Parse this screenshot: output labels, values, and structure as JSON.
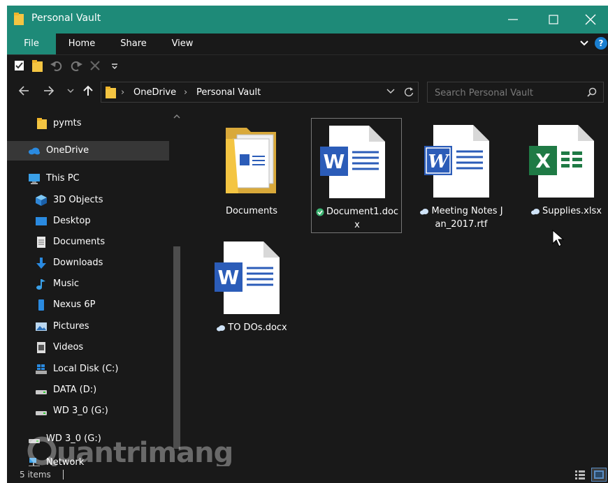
{
  "window": {
    "title": "Personal Vault"
  },
  "ribbon": {
    "tabs": [
      {
        "label": "File"
      },
      {
        "label": "Home"
      },
      {
        "label": "Share"
      },
      {
        "label": "View"
      }
    ]
  },
  "address": {
    "crumbs": [
      "OneDrive",
      "Personal Vault"
    ],
    "search_placeholder": "Search Personal Vault"
  },
  "nav_pane": {
    "items": [
      {
        "label": "pymts",
        "icon": "folder-icon"
      },
      {
        "label": "OneDrive",
        "icon": "cloud-icon"
      },
      {
        "label": "This PC",
        "icon": "computer-icon"
      },
      {
        "label": "3D Objects",
        "icon": "cube-icon"
      },
      {
        "label": "Desktop",
        "icon": "desktop-icon"
      },
      {
        "label": "Documents",
        "icon": "documents-icon"
      },
      {
        "label": "Downloads",
        "icon": "download-icon"
      },
      {
        "label": "Music",
        "icon": "music-icon"
      },
      {
        "label": "Nexus 6P",
        "icon": "phone-icon"
      },
      {
        "label": "Pictures",
        "icon": "pictures-icon"
      },
      {
        "label": "Videos",
        "icon": "video-icon"
      },
      {
        "label": "Local Disk (C:)",
        "icon": "windows-drive-icon"
      },
      {
        "label": "DATA (D:)",
        "icon": "drive-icon"
      },
      {
        "label": "WD 3_0 (G:)",
        "icon": "drive-icon"
      },
      {
        "label": "WD 3_0 (G:)",
        "icon": "drive-icon"
      },
      {
        "label": "Network",
        "icon": "network-icon"
      }
    ],
    "selected": "OneDrive"
  },
  "files": [
    {
      "name": "Documents",
      "type": "folder",
      "status": ""
    },
    {
      "name": "Document1.docx",
      "type": "word",
      "status": "synced"
    },
    {
      "name": "Meeting Notes Jan_2017.rtf",
      "type": "wordpad",
      "status": "cloud"
    },
    {
      "name": "Supplies.xlsx",
      "type": "excel",
      "status": "cloud"
    },
    {
      "name": "TO DOs.docx",
      "type": "word",
      "status": "cloud"
    }
  ],
  "status_bar": {
    "item_count": "5 items"
  },
  "watermark": {
    "text": "uantrimang"
  },
  "colors": {
    "accent": "#1e8a78",
    "background": "#191919",
    "word_blue": "#2b5cb8",
    "excel_green": "#1f7a45"
  }
}
